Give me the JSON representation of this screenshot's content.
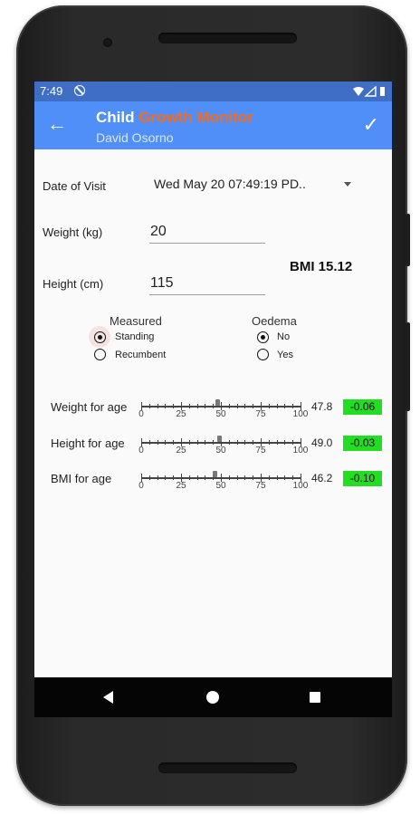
{
  "status_bar": {
    "time": "7:49",
    "icons": [
      "dnd-icon",
      "wifi-icon",
      "signal-icon",
      "battery-icon"
    ]
  },
  "app_bar": {
    "title_part1": "Child",
    "title_part2": "Growth Monitor",
    "subtitle": "David Osorno",
    "back_icon": "arrow-back-icon",
    "confirm_icon": "check-icon",
    "colors": {
      "bar": "#4f8ff7",
      "accent": "#f46a1e"
    }
  },
  "form": {
    "date_label": "Date of Visit",
    "date_value": "Wed May 20 07:49:19 PD..",
    "weight_label": "Weight (kg)",
    "weight_value": "20",
    "height_label": "Height (cm)",
    "height_value": "115",
    "bmi_text": "BMI 15.12"
  },
  "measured": {
    "title": "Measured",
    "options": [
      {
        "label": "Standing",
        "checked": true
      },
      {
        "label": "Recumbent",
        "checked": false
      }
    ]
  },
  "oedema": {
    "title": "Oedema",
    "options": [
      {
        "label": "No",
        "checked": true
      },
      {
        "label": "Yes",
        "checked": false
      }
    ]
  },
  "indicators": {
    "tick_labels": [
      "0",
      "25",
      "50",
      "75",
      "100"
    ],
    "rows": [
      {
        "label": "Weight for age",
        "percentile": 47.8,
        "percentile_text": "47.8",
        "zscore": "-0.06"
      },
      {
        "label": "Height for age",
        "percentile": 49.0,
        "percentile_text": "49.0",
        "zscore": "-0.03"
      },
      {
        "label": "BMI for age",
        "percentile": 46.2,
        "percentile_text": "46.2",
        "zscore": "-0.10"
      }
    ],
    "zscore_color": "#22dd22"
  },
  "nav_bar": {
    "icons": [
      "nav-back-icon",
      "nav-home-icon",
      "nav-recents-icon"
    ]
  }
}
